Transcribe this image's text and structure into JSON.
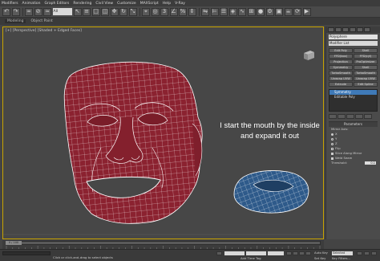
{
  "menubar": {
    "items": [
      "Modifiers",
      "Animation",
      "Graph Editors",
      "Rendering",
      "Civil View",
      "Customize",
      "MAXScript",
      "Help",
      "V-Ray"
    ]
  },
  "toolbar": {
    "selection_filter": "All"
  },
  "ribbon": {
    "tabs": [
      "Modeling",
      "Object Paint"
    ]
  },
  "viewport": {
    "label": "[+] [Perspective] [Shaded + Edged Faces]",
    "caption_line1": "I start the mouth by the inside",
    "caption_line2": "and expand it out",
    "colors": {
      "face": "#8b2230",
      "inner": "#2e5a8a",
      "wire": "#ffffff",
      "background": "#474747",
      "border": "#c9a400"
    }
  },
  "command_panel": {
    "object_name": "Polysphere",
    "modifier_list": "Modifier List",
    "buttons": [
      "Edit Poly",
      "Shell",
      "FFD(box)",
      "FFD(cyl)",
      "Projection",
      "ProOptimizer",
      "Symmetry",
      "Shell",
      "TurboSmooth",
      "TurboSmooth",
      "Unwrap UVW",
      "Unwrap UVW",
      "Extrude",
      "Edit Spline"
    ],
    "stack": [
      "Symmetry",
      "Editable Poly"
    ],
    "rollout_title": "Parameters",
    "mirror_axis_label": "Mirror Axis:",
    "axes": [
      "X",
      "Y",
      "Z"
    ],
    "flip_label": "Flip",
    "slice_label": "Slice Along Mirror",
    "weld_label": "Weld Seam",
    "threshold_label": "Threshold:",
    "threshold_value": "0.1"
  },
  "timeline": {
    "frame_label": "0 / 100",
    "ruler_ticks": [
      "0",
      "10",
      "20",
      "30",
      "40",
      "50",
      "60",
      "70",
      "80",
      "90",
      "100"
    ]
  },
  "statusbar": {
    "prompt": "Click or click-and-drag to select objects",
    "auto_key": "Auto Key",
    "selected": "Selected",
    "set_key": "Set Key",
    "key_filters": "Key Filters...",
    "add_time_tag": "Add Time Tag"
  }
}
